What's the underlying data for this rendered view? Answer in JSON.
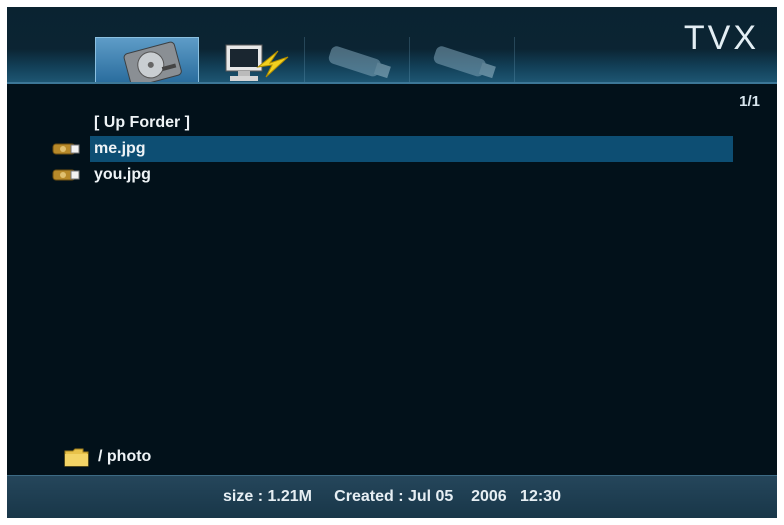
{
  "brand": "TVX",
  "tabs": [
    {
      "name": "hard-disk",
      "selected": true
    },
    {
      "name": "network",
      "selected": false
    },
    {
      "name": "usb-1",
      "selected": false
    },
    {
      "name": "usb-2",
      "selected": false
    }
  ],
  "page_indicator": "1/1",
  "file_list": {
    "items": [
      {
        "label": "[ Up Forder ]",
        "icon": "",
        "selected": false
      },
      {
        "label": "me.jpg",
        "icon": "photo-icon",
        "selected": true
      },
      {
        "label": "you.jpg",
        "icon": "photo-icon",
        "selected": false
      }
    ]
  },
  "current_path": "/ photo",
  "status": {
    "text": "size : 1.21M     Created : Jul 05    2006   12:30"
  },
  "colors": {
    "background": "#02111a",
    "selection": "#0d4e73",
    "accent": "#3c7797"
  }
}
